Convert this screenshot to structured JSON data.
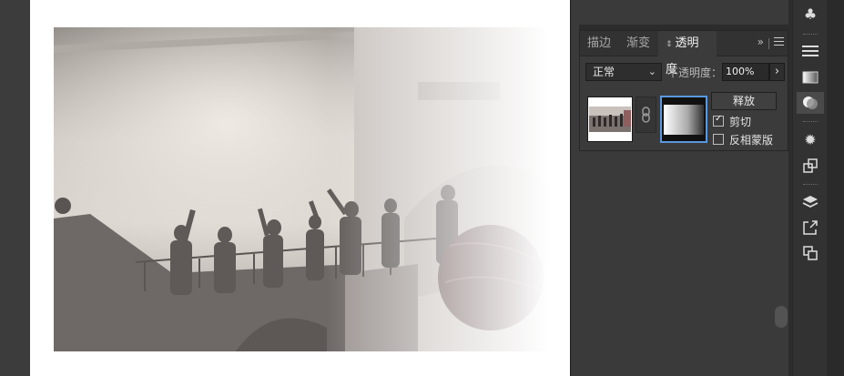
{
  "transparency_panel": {
    "tabs": [
      {
        "label": "描边"
      },
      {
        "label": "渐变"
      },
      {
        "label": "透明度"
      }
    ],
    "more_icon": "double-chevron-right-icon",
    "blend_mode": "正常",
    "opacity_label": "不透明度：",
    "opacity_value": "100%",
    "opacity_arrow": "›",
    "release_label": "释放",
    "clip_label": "剪切",
    "clip_checked": true,
    "invert_label": "反相蒙版",
    "invert_checked": false
  },
  "toolbar": {
    "icons": [
      "club-icon",
      "lines-icon",
      "gradient-icon",
      "transparency-icon",
      "sun-icon",
      "export-icon",
      "layers-icon",
      "link-out-icon",
      "artboards-icon"
    ],
    "active": "transparency-icon"
  },
  "colors": {
    "panel_bg": "#3b3b3b",
    "accent": "#5a98e0",
    "artboard": "#ffffff"
  }
}
